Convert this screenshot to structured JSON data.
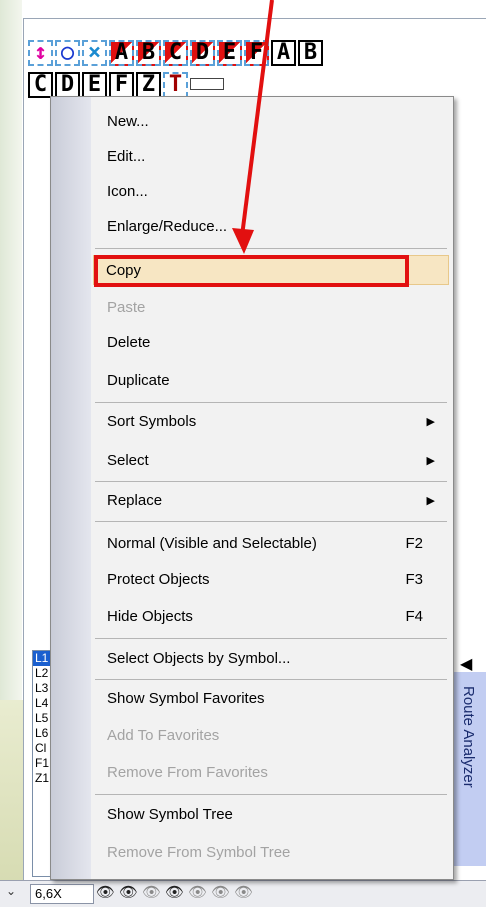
{
  "symbols": {
    "row1": [
      {
        "glyph": "↕",
        "color": "#e000a0",
        "style": "plain"
      },
      {
        "glyph": "○",
        "color": "#1a3ad0",
        "style": "plain"
      },
      {
        "glyph": "×",
        "color": "#1a8ad0",
        "style": "plain"
      },
      {
        "glyph": "A",
        "color": "#000",
        "style": "red"
      },
      {
        "glyph": "B",
        "color": "#000",
        "style": "red"
      },
      {
        "glyph": "C",
        "color": "#000",
        "style": "red"
      },
      {
        "glyph": "D",
        "color": "#000",
        "style": "red"
      },
      {
        "glyph": "E",
        "color": "#000",
        "style": "red"
      },
      {
        "glyph": "F",
        "color": "#000",
        "style": "red"
      },
      {
        "glyph": "A",
        "color": "#000",
        "style": "solid"
      },
      {
        "glyph": "B",
        "color": "#000",
        "style": "solid"
      }
    ],
    "row2": [
      {
        "glyph": "C",
        "color": "#000",
        "style": "solid"
      },
      {
        "glyph": "D",
        "color": "#000",
        "style": "solid"
      },
      {
        "glyph": "E",
        "color": "#000",
        "style": "solid"
      },
      {
        "glyph": "F",
        "color": "#000",
        "style": "solid"
      },
      {
        "glyph": "Z",
        "color": "#000",
        "style": "solid"
      },
      {
        "glyph": "T",
        "color": "#a00000",
        "style": "plain"
      }
    ]
  },
  "route_list": [
    "L1",
    "L2",
    "L3",
    "L4",
    "L5",
    "L6",
    "Cl",
    "F1",
    "Z1"
  ],
  "side_tab": {
    "label": "Route Analyzer"
  },
  "status": {
    "zoom": "6,6X"
  },
  "menu": {
    "new": "New...",
    "edit": "Edit...",
    "icon": "Icon...",
    "enlarge": "Enlarge/Reduce...",
    "copy": "Copy",
    "paste": "Paste",
    "delete": "Delete",
    "duplicate": "Duplicate",
    "sort": "Sort Symbols",
    "select": "Select",
    "replace": "Replace",
    "normal": "Normal (Visible and Selectable)",
    "normal_sc": "F2",
    "protect": "Protect Objects",
    "protect_sc": "F3",
    "hide": "Hide Objects",
    "hide_sc": "F4",
    "select_by_symbol": "Select Objects by Symbol...",
    "show_fav": "Show Symbol Favorites",
    "add_fav": "Add To Favorites",
    "remove_fav": "Remove From Favorites",
    "show_tree": "Show Symbol Tree",
    "remove_tree": "Remove From Symbol Tree"
  },
  "colors": {
    "highlight_box": "#e21010",
    "arrow": "#e21010",
    "menu_hover": "#f7e6c3"
  }
}
